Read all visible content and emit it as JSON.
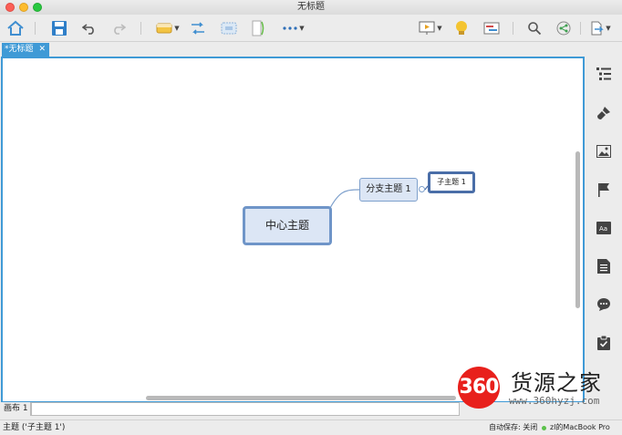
{
  "window": {
    "title": "无标题"
  },
  "toolbar": {
    "items": [
      "home-icon",
      "save-icon",
      "undo-icon",
      "redo-icon",
      "topic-style-icon",
      "relationship-icon",
      "boundary-icon",
      "summary-icon",
      "more-icon",
      "presentation-icon",
      "idea-icon",
      "gantt-icon",
      "search-icon",
      "share-icon",
      "export-icon"
    ]
  },
  "tabs": [
    {
      "label": "*无标题",
      "close": "✕"
    }
  ],
  "mindmap": {
    "central_topic": "中心主题",
    "branch_topic": "分支主题 1",
    "sub_topic": "子主题 1"
  },
  "sheet": {
    "label": "画布 1"
  },
  "statusbar": {
    "selection": "主题 ('子主题 1')",
    "autosave": "自动保存: 关闭",
    "user": "zl的MacBook Pro"
  },
  "right_panel": {
    "items": [
      "outline-icon",
      "format-icon",
      "image-icon",
      "marker-icon",
      "text-icon",
      "notes-icon",
      "comments-icon",
      "task-icon"
    ]
  },
  "watermark": {
    "logo": "360",
    "title": "货源之家",
    "url": "www.360hyzj.com"
  },
  "colors": {
    "accent": "#3f9ad6",
    "topic_fill": "#dce6f5",
    "topic_border": "#6f95c8"
  }
}
